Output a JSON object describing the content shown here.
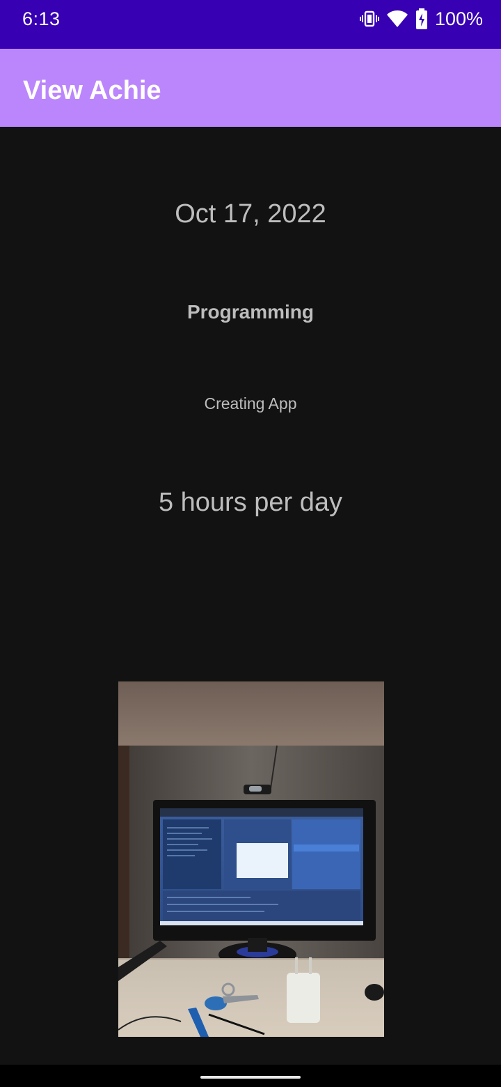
{
  "status_bar": {
    "time": "6:13",
    "battery_percent": "100%",
    "icons": [
      "vibrate-icon",
      "wifi-icon",
      "battery-charging-icon"
    ]
  },
  "app_bar": {
    "title": "View Achie"
  },
  "achievement": {
    "date": "Oct 17, 2022",
    "category": "Programming",
    "description": "Creating App",
    "duration": "5 hours per day"
  },
  "colors": {
    "status_bar": "#3700B3",
    "app_bar": "#BB86FC",
    "background": "#121212",
    "text": "#BDBDBD"
  }
}
